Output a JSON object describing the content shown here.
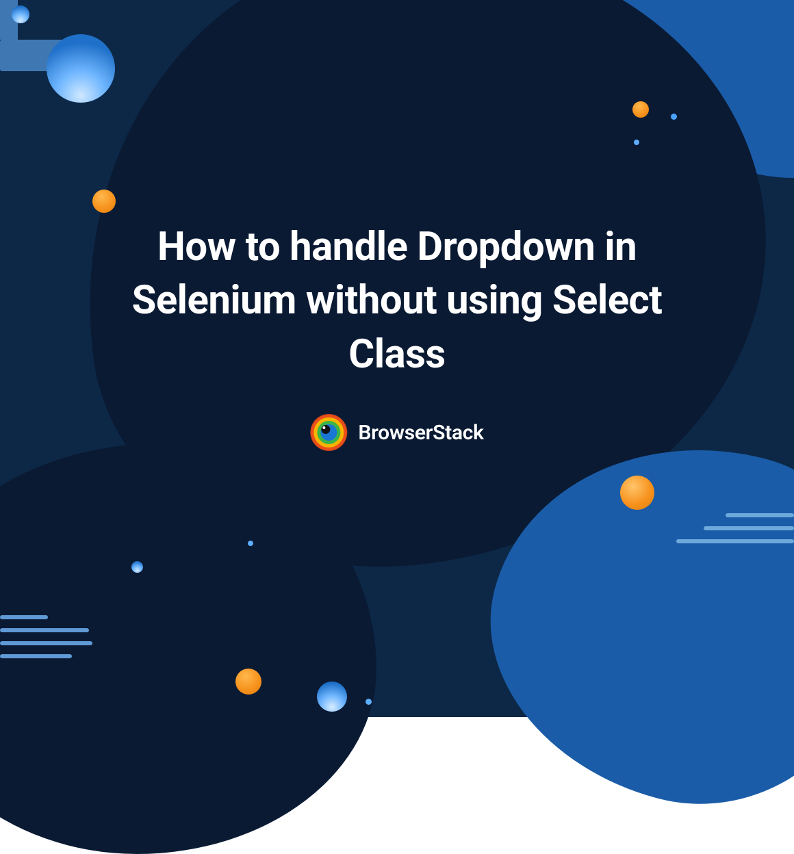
{
  "title": "How to handle Dropdown in Selenium without using Select Class",
  "brand": {
    "name": "BrowserStack"
  },
  "colors": {
    "bg_deep": "#0a1a33",
    "bg_mid": "#0d2847",
    "accent_blue": "#1a5ca8",
    "orange": "#f7931e",
    "light_blue": "#5daeff",
    "text": "#ffffff"
  }
}
